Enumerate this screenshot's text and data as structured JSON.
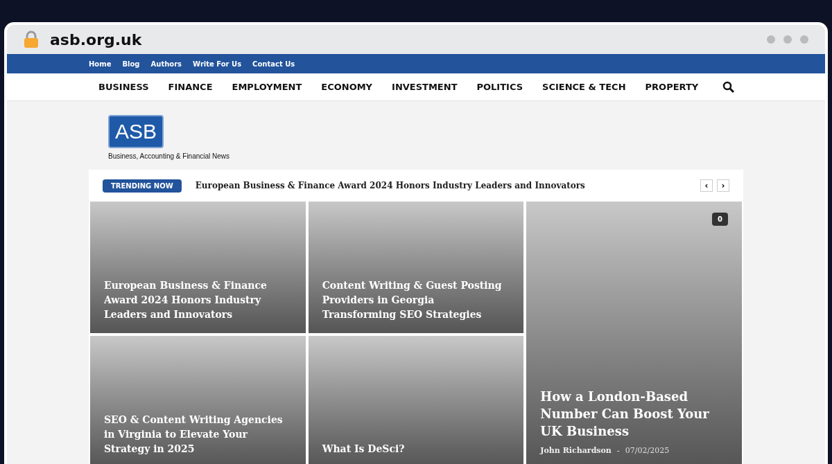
{
  "browser": {
    "address": "asb.org.uk"
  },
  "top_links": [
    "Home",
    "Blog",
    "Authors",
    "Write For Us",
    "Contact Us"
  ],
  "nav": [
    "BUSINESS",
    "FINANCE",
    "EMPLOYMENT",
    "ECONOMY",
    "INVESTMENT",
    "POLITICS",
    "SCIENCE & TECH",
    "PROPERTY"
  ],
  "logo": {
    "mark": "ASB",
    "tagline": "Business, Accounting & Financial News"
  },
  "trending": {
    "badge": "TRENDING NOW",
    "headline": "European Business & Finance Award 2024 Honors Industry Leaders and Innovators",
    "prev": "‹",
    "next": "›"
  },
  "posts": [
    {
      "title": "European Business & Finance Award 2024 Honors Industry Leaders and Innovators"
    },
    {
      "title": "Content Writing & Guest Posting Providers in Georgia Transforming SEO Strategies"
    },
    {
      "title": "SEO & Content Writing Agencies in Virginia to Elevate Your Strategy in 2025"
    },
    {
      "title": "What Is DeSci?"
    },
    {
      "title": "How a London-Based Number Can Boost Your UK Business",
      "comments": "0",
      "author": "John Richardson",
      "separator": "-",
      "date": "07/02/2025"
    }
  ]
}
